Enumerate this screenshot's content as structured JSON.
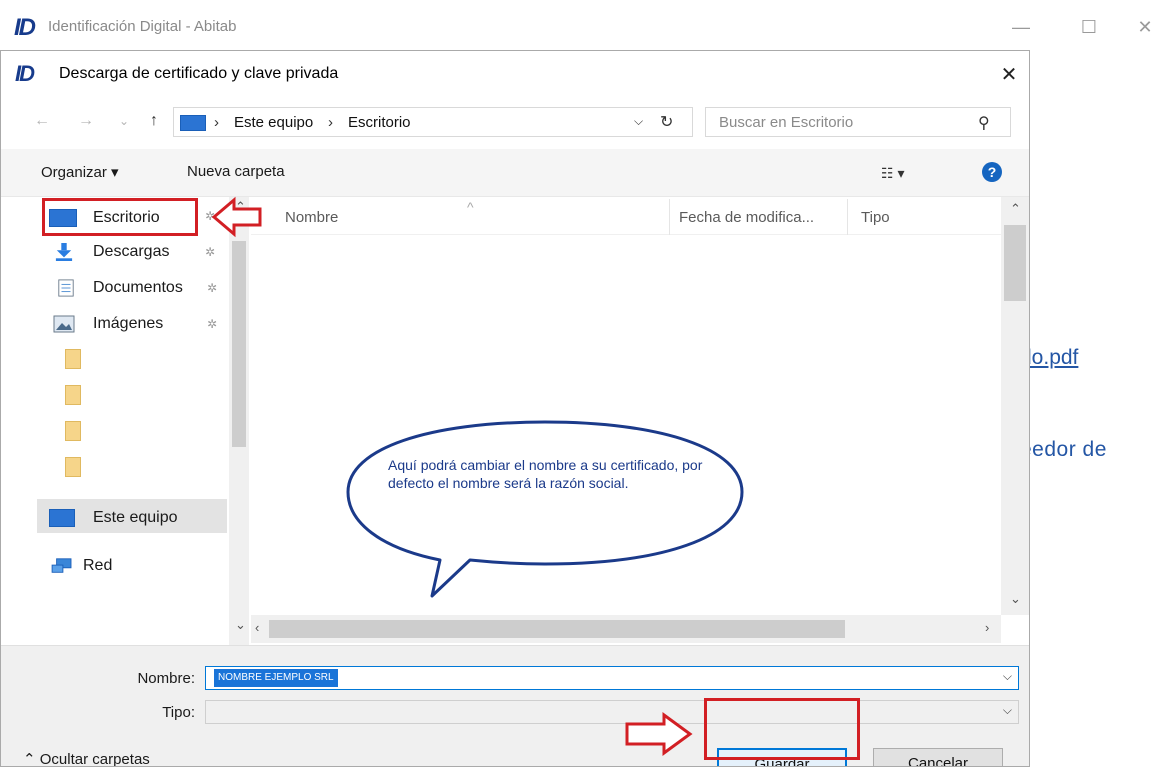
{
  "app": {
    "logo": "ID",
    "title": "Identificación Digital - Abitab",
    "minimize": "—",
    "maximize": "☐",
    "close": "✕",
    "link_fragment": "do.pdf",
    "text_fragment": "eedor de"
  },
  "dialog": {
    "logo": "ID",
    "title": "Descarga de certificado y clave privada",
    "close": "✕",
    "nav": {
      "back": "←",
      "forward": "→",
      "recent": "⌄",
      "up": "↑"
    },
    "address": {
      "crumbs": [
        "Este equipo",
        "Escritorio"
      ],
      "separator": "›",
      "dropdown": "⌵",
      "refresh": "↻"
    },
    "search": {
      "placeholder": "Buscar en Escritorio",
      "icon": "⚲"
    },
    "commands": {
      "organize": "Organizar ▾",
      "new_folder": "Nueva carpeta",
      "view": "☷ ▾",
      "help": "?"
    },
    "sidebar": {
      "items": [
        {
          "label": "Escritorio",
          "icon": "desktop-icon",
          "pinned": true
        },
        {
          "label": "Descargas",
          "icon": "download-icon",
          "pinned": true
        },
        {
          "label": "Documentos",
          "icon": "documents-icon",
          "pinned": true
        },
        {
          "label": "Imágenes",
          "icon": "pictures-icon",
          "pinned": true
        }
      ],
      "pin": "✲",
      "this_pc": "Este equipo",
      "network": "Red",
      "collapse_arrow": "⌄"
    },
    "columns": [
      "Nombre",
      "Fecha de modifica...",
      "Tipo"
    ],
    "sort_indicator": "^",
    "scroll": {
      "up": "⌃",
      "down": "⌄",
      "left": "‹",
      "right": "›"
    },
    "filename": {
      "label": "Nombre:",
      "value": "NOMBRE EJEMPLO SRL",
      "dropdown": "⌵"
    },
    "filetype": {
      "label": "Tipo:",
      "value": "",
      "dropdown": "⌵"
    },
    "hide_folders": "⌃  Ocultar carpetas",
    "buttons": {
      "save": "Guardar",
      "cancel": "Cancelar"
    }
  },
  "annotation": {
    "callout_text": "Aquí podrá cambiar el nombre a su certificado, por defecto el nombre será la razón social.",
    "highlight_color": "#d21f24",
    "callout_color": "#1b3a8a"
  },
  "colors": {
    "accent": "#0078d7",
    "selection": "#1a74d8",
    "link": "#2456a5"
  }
}
